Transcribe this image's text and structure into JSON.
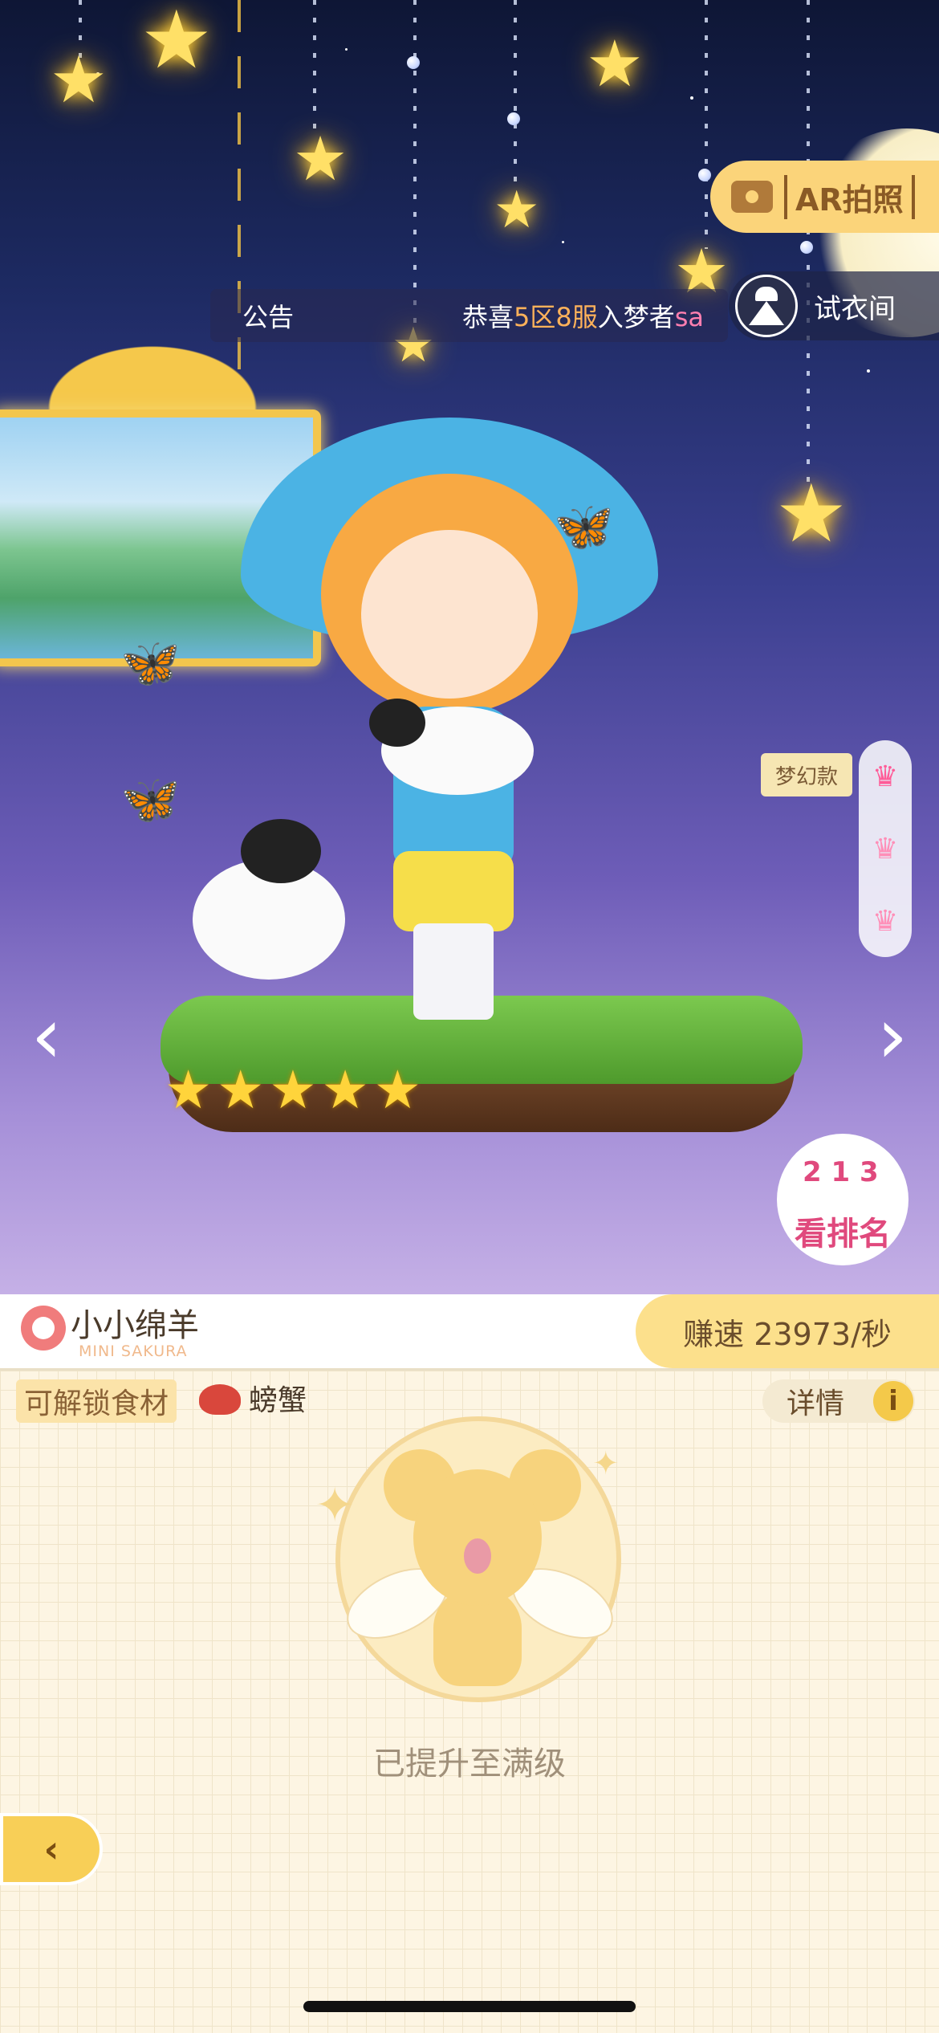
{
  "ar_button": {
    "label": "AR拍照",
    "icon": "camera-icon"
  },
  "notice": {
    "label": "公告",
    "message_parts": [
      "恭喜",
      "5区",
      "8服",
      "入梦者",
      "sa"
    ]
  },
  "fitting_room": {
    "label": "试衣间",
    "icon": "dress-icon"
  },
  "rarity": {
    "label": "梦幻款",
    "active_index": 0,
    "levels": 3
  },
  "rating": {
    "stars": 5
  },
  "ranking": {
    "label": "看排名",
    "podium": "2 1 3"
  },
  "character": {
    "name": "小小绵羊",
    "subtitle": "MINI SAKURA"
  },
  "speed": {
    "label": "赚速 23973/秒"
  },
  "ingredients": {
    "unlock_label": "可解锁食材",
    "item_name": "螃蟹",
    "item_icon": "crab-icon"
  },
  "details": {
    "label": "详情",
    "icon_glyph": "i"
  },
  "status": {
    "maxed": "已提升至满级"
  },
  "colors": {
    "accent_yellow": "#fce08c",
    "panel_bg": "#fdf5e3",
    "pink": "#e0497d"
  }
}
